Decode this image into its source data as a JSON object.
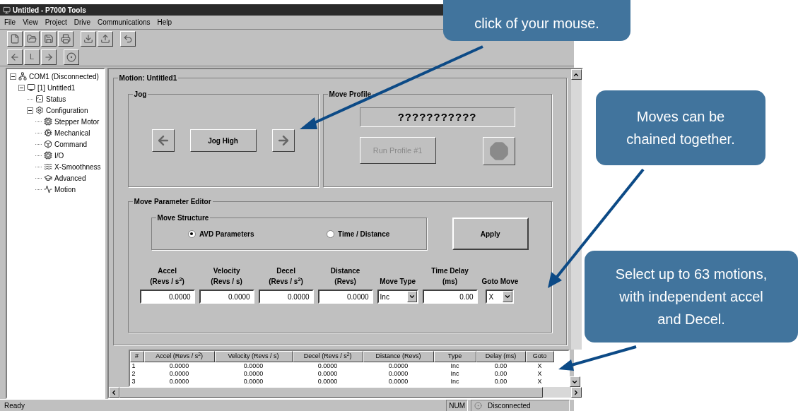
{
  "window": {
    "title": "Untitled - P7000 Tools"
  },
  "menu": [
    "File",
    "View",
    "Project",
    "Drive",
    "Communications",
    "Help"
  ],
  "toolbar_2": {
    "letter_button": "L"
  },
  "tree": [
    {
      "label": "COM1 (Disconnected)",
      "expanded": true,
      "children": [
        {
          "label": "[1] Untitled1",
          "expanded": true,
          "children": [
            {
              "label": "Status"
            },
            {
              "label": "Configuration",
              "expanded": true,
              "children": [
                {
                  "label": "Stepper Motor"
                },
                {
                  "label": "Mechanical"
                },
                {
                  "label": "Command"
                },
                {
                  "label": "I/O"
                },
                {
                  "label": "X-Smoothness"
                },
                {
                  "label": "Advanced"
                },
                {
                  "label": "Motion"
                }
              ]
            }
          ]
        }
      ]
    }
  ],
  "panel": {
    "title": "Motion: Untitled1"
  },
  "jog": {
    "title": "Jog",
    "button": "Jog High"
  },
  "move_profile": {
    "title": "Move Profile",
    "display": "???????????",
    "run_button": "Run Profile #1",
    "run_disabled": true,
    "stop_disabled": true
  },
  "editor": {
    "title": "Move Parameter Editor",
    "structure": {
      "title": "Move Structure",
      "options": [
        {
          "label": "AVD Parameters",
          "selected": true
        },
        {
          "label": "Time / Distance",
          "selected": false
        }
      ]
    },
    "apply": "Apply",
    "fields": [
      {
        "kind": "text",
        "label": [
          "Accel",
          "(Revs / s$^{2}$)"
        ],
        "value": "0.0000"
      },
      {
        "kind": "text",
        "label": [
          "Velocity",
          "(Revs / s)"
        ],
        "value": "0.0000"
      },
      {
        "kind": "text",
        "label": [
          "Decel",
          "(Revs / s$^{2}$)"
        ],
        "value": "0.0000"
      },
      {
        "kind": "text",
        "label": [
          "Distance",
          "(Revs)"
        ],
        "value": "0.0000"
      },
      {
        "kind": "select",
        "label": [
          "Move Type"
        ],
        "value": "Inc"
      },
      {
        "kind": "text",
        "label": [
          "Time Delay",
          "(ms)"
        ],
        "value": "0.00"
      },
      {
        "kind": "select",
        "label": [
          "Goto Move"
        ],
        "value": "X"
      }
    ]
  },
  "table": {
    "columns": [
      "#",
      "Accel (Revs / s$^{2}$)",
      "Velocity (Revs / s)",
      "Decel (Revs / s$^{2}$)",
      "Distance (Revs)",
      "Type",
      "Delay (ms)",
      "Goto"
    ],
    "rows": [
      [
        "1",
        "0.0000",
        "0.0000",
        "0.0000",
        "0.0000",
        "Inc",
        "0.00",
        "X"
      ],
      [
        "2",
        "0.0000",
        "0.0000",
        "0.0000",
        "0.0000",
        "Inc",
        "0.00",
        "X"
      ],
      [
        "3",
        "0.0000",
        "0.0000",
        "0.0000",
        "0.0000",
        "Inc",
        "0.00",
        "X"
      ]
    ]
  },
  "status_bar": {
    "text": "Ready",
    "num": "NUM",
    "connection": "Disconnected"
  },
  "callouts": [
    "click of your mouse.",
    "Moves can be chained together.",
    "Select up to 63 motions, with independent accel and Decel."
  ]
}
